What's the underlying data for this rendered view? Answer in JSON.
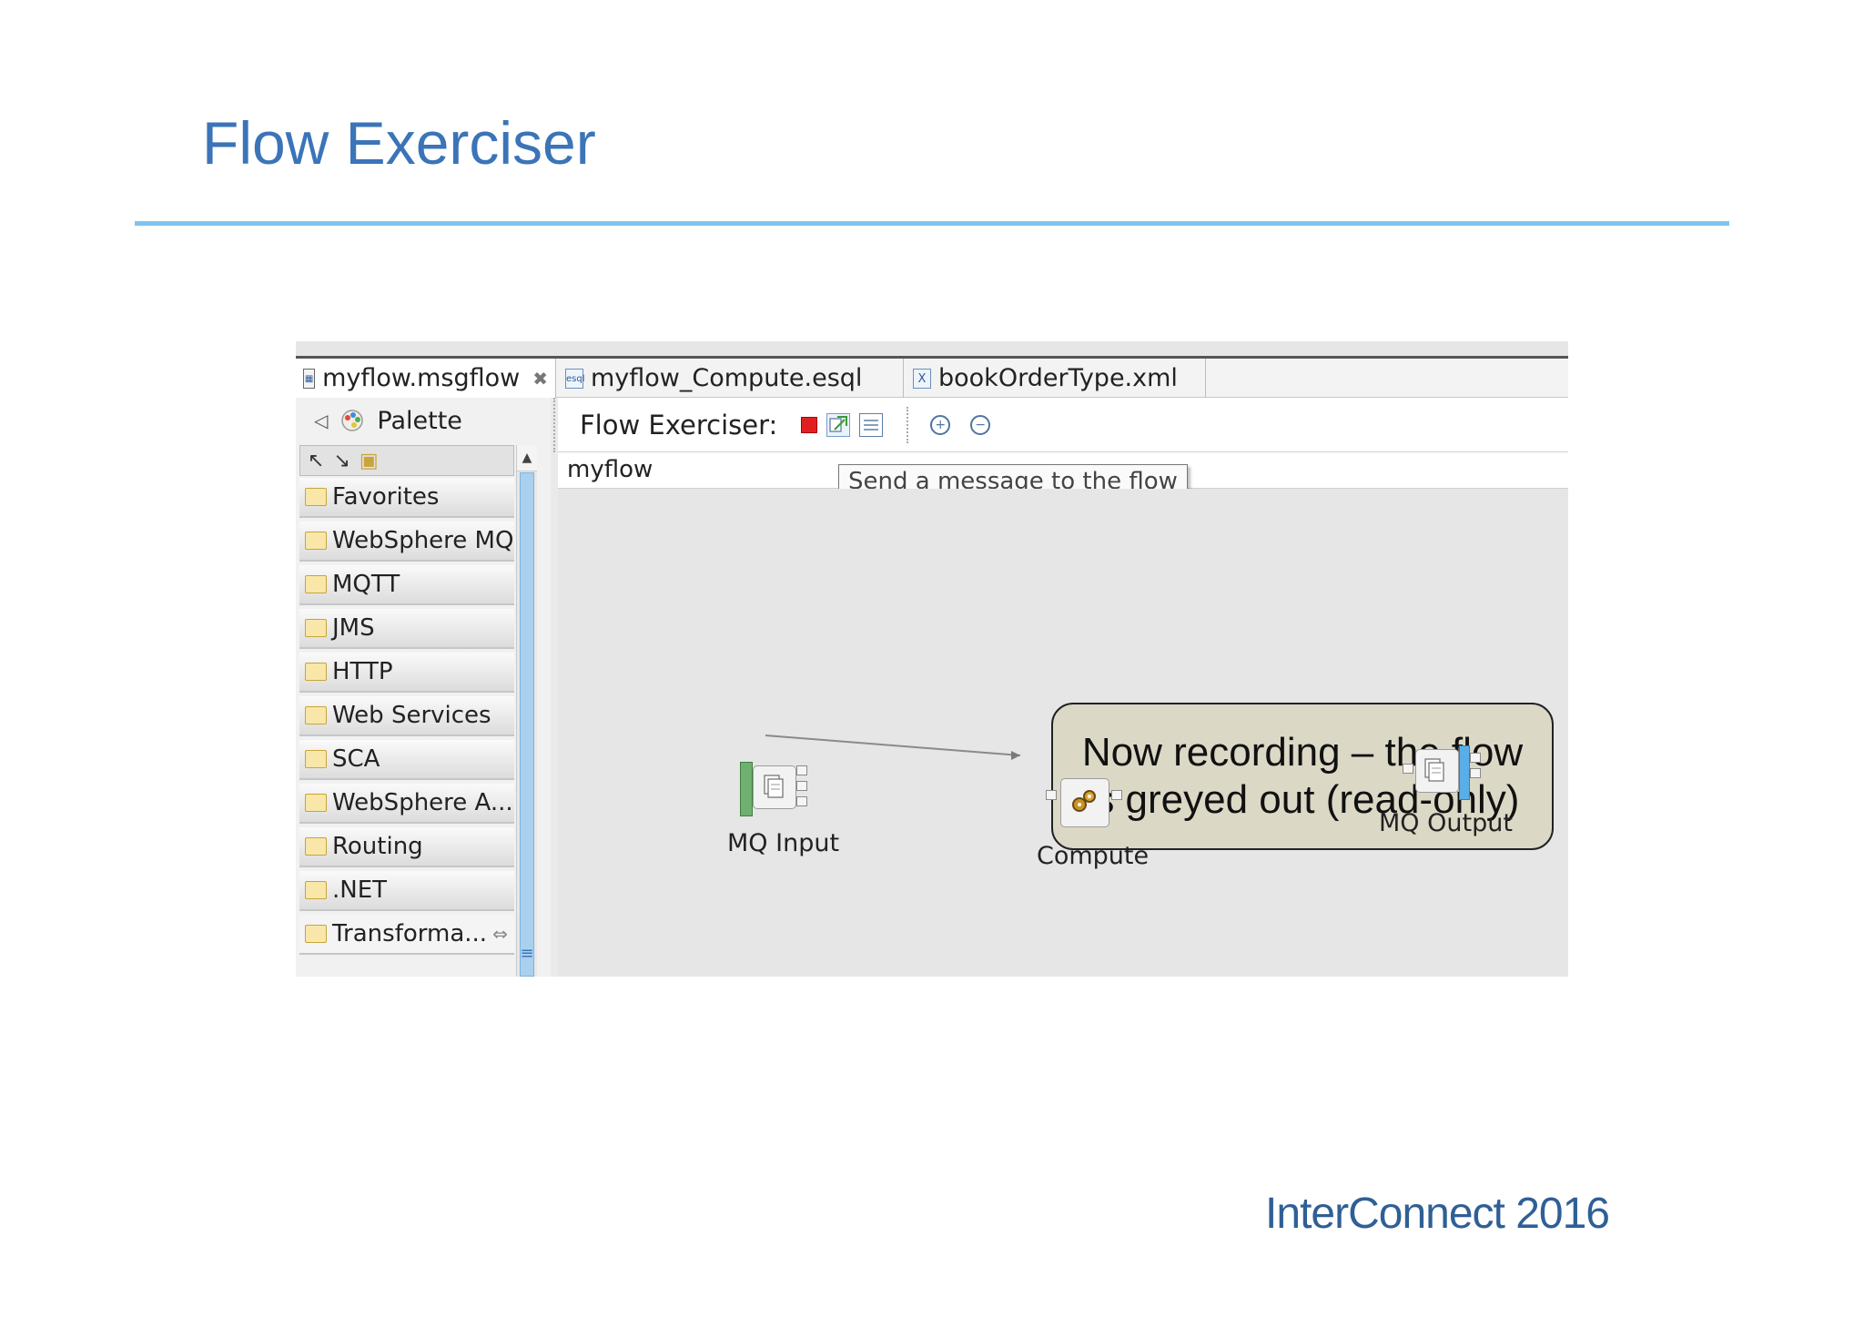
{
  "slide": {
    "title": "Flow Exerciser",
    "footer": "InterConnect 2016"
  },
  "tabs": [
    {
      "label": "myflow.msgflow",
      "icon": "msgflow-icon"
    },
    {
      "label": "myflow_Compute.esql",
      "icon": "esql-file-icon"
    },
    {
      "label": "bookOrderType.xml",
      "icon": "xml-file-icon"
    }
  ],
  "palette": {
    "title": "Palette",
    "drawers": [
      {
        "label": "Favorites"
      },
      {
        "label": "WebSphere MQ"
      },
      {
        "label": "MQTT"
      },
      {
        "label": "JMS"
      },
      {
        "label": "HTTP"
      },
      {
        "label": "Web Services"
      },
      {
        "label": "SCA"
      },
      {
        "label": "WebSphere A..."
      },
      {
        "label": "Routing"
      },
      {
        "label": ".NET"
      },
      {
        "label": "Transforma..."
      }
    ]
  },
  "editor": {
    "toolbar_label": "Flow Exerciser:",
    "breadcrumb": "myflow",
    "tooltip": "Send a message to the flow"
  },
  "callout": {
    "line1": "Now recording – the flow",
    "line2": "is greyed out (read-only)"
  },
  "nodes": [
    {
      "label": "MQ Input"
    },
    {
      "label": "Compute"
    },
    {
      "label": "MQ Output"
    }
  ],
  "colors": {
    "title": "#3b74b8",
    "rule": "#7cc6ee",
    "stop": "#e02020",
    "callout_bg": "#dcd8c6"
  }
}
